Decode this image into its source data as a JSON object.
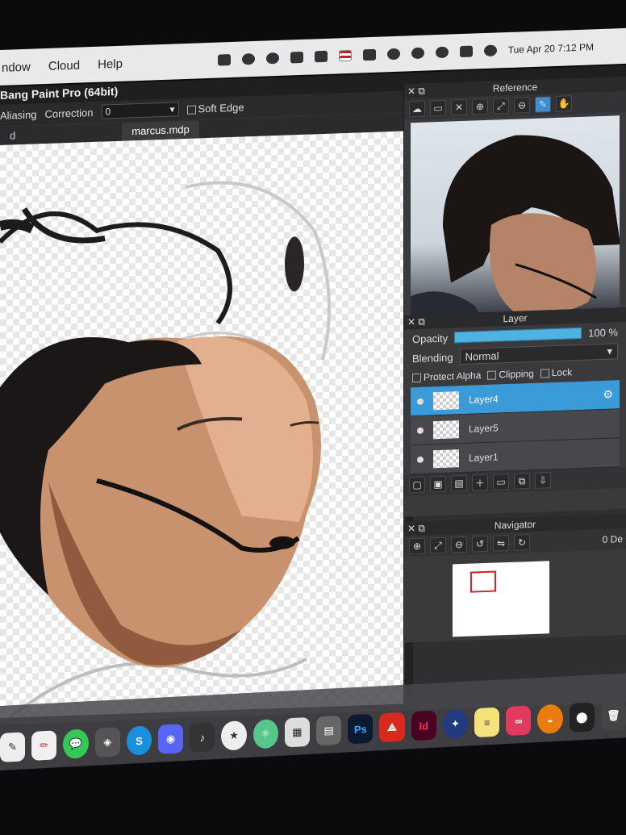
{
  "menubar": {
    "items": [
      "ndow",
      "Cloud",
      "Help"
    ],
    "datetime": "Tue Apr 20  7:12 PM"
  },
  "app": {
    "title": "Bang Paint Pro (64bit)",
    "toolbar": {
      "aliasing_label": "Aliasing",
      "correction_label": "Correction",
      "correction_value": "0",
      "soft_edge_label": "Soft Edge"
    },
    "tabs": [
      "d",
      "marcus.mdp"
    ]
  },
  "reference_panel": {
    "title": "Reference"
  },
  "layer_panel": {
    "title": "Layer",
    "opacity_label": "Opacity",
    "opacity_value": "100 %",
    "opacity_fraction": 1.0,
    "blending_label": "Blending",
    "blending_value": "Normal",
    "protect_alpha_label": "Protect Alpha",
    "clipping_label": "Clipping",
    "lock_label": "Lock",
    "layers": [
      "Layer4",
      "Layer5",
      "Layer1"
    ],
    "selected_layer": "Layer4"
  },
  "navigator_panel": {
    "title": "Navigator",
    "angle_value": "0 De"
  },
  "dock": {
    "labels": [
      "Ps",
      "Id",
      "S"
    ]
  },
  "colors": {
    "accent": "#3b9ad8",
    "panel_bg": "#3a3a3d"
  }
}
